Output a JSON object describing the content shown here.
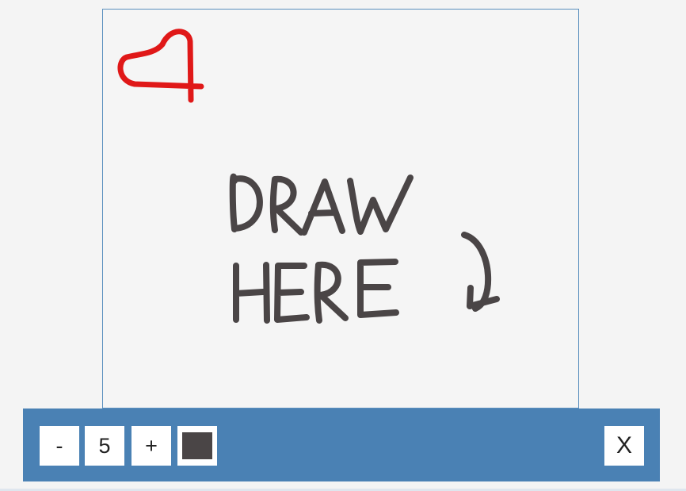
{
  "canvas": {
    "drawing_text_line1": "DRAW",
    "drawing_text_line2": "HERE",
    "heart_color": "#e01818",
    "ink_color": "#4a4546"
  },
  "toolbar": {
    "background": "#4a81b4",
    "decrease_label": "-",
    "brush_size": "5",
    "increase_label": "+",
    "current_color": "#4a4546",
    "close_label": "X"
  },
  "icons": {
    "heart": "heart-doodle",
    "arrow": "curved-arrow-down-doodle"
  }
}
